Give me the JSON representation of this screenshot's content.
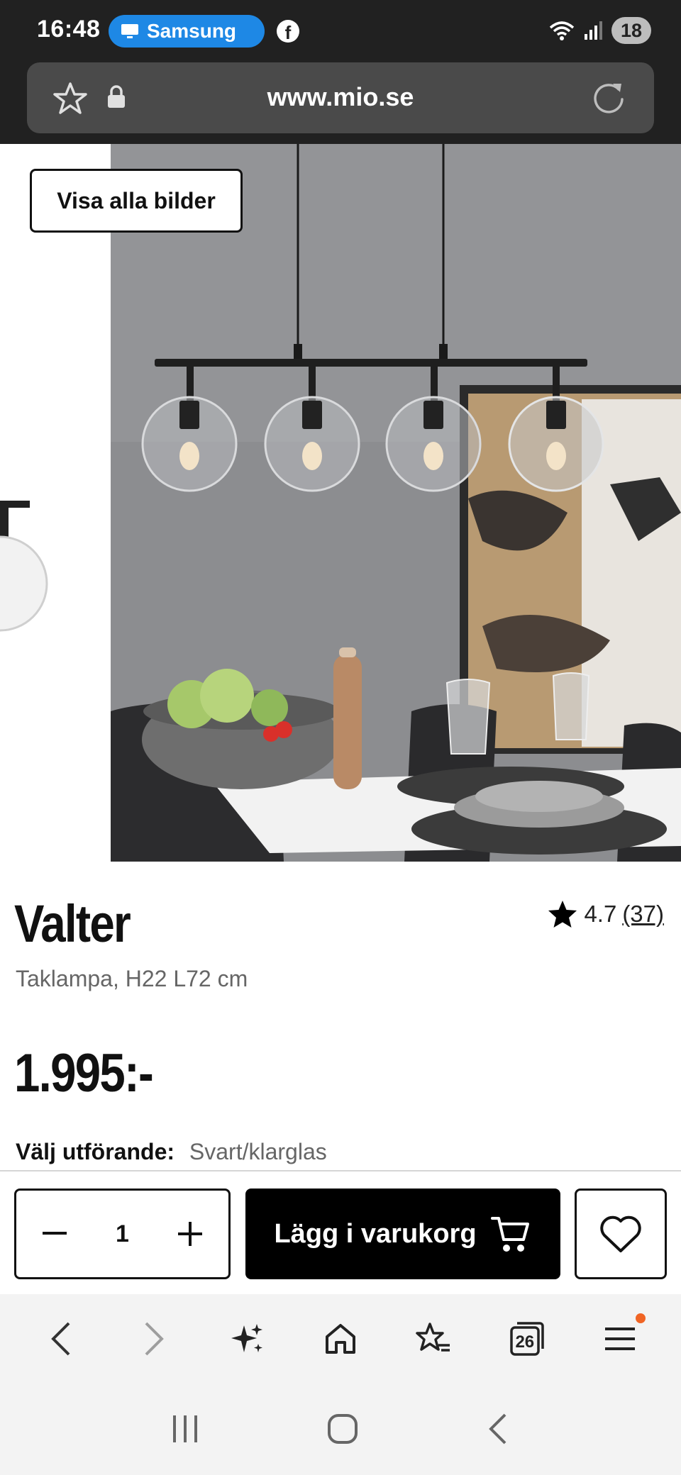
{
  "status_bar": {
    "time": "16:48",
    "notification_label": "Samsung",
    "notification_icon": "screen-share-icon",
    "app_icon": "facebook-icon",
    "battery": "18"
  },
  "browser": {
    "url": "www.mio.se"
  },
  "gallery": {
    "view_all_label": "Visa alla bilder"
  },
  "product": {
    "name": "Valter",
    "rating": "4.7",
    "review_count": "(37)",
    "subtitle": "Taklampa, H22 L72 cm",
    "price": "1.995:-",
    "variant_label": "Välj utförande:",
    "variant_value": "Svart/klarglas"
  },
  "actions": {
    "quantity": "1",
    "add_to_cart_label": "Lägg i varukorg"
  },
  "browser_nav": {
    "tabs_count": "26"
  },
  "colors": {
    "status_bar_bg": "#212121",
    "notification_pill": "#1e88e5",
    "menu_badge": "#f06424",
    "cta_bg": "#000000"
  }
}
